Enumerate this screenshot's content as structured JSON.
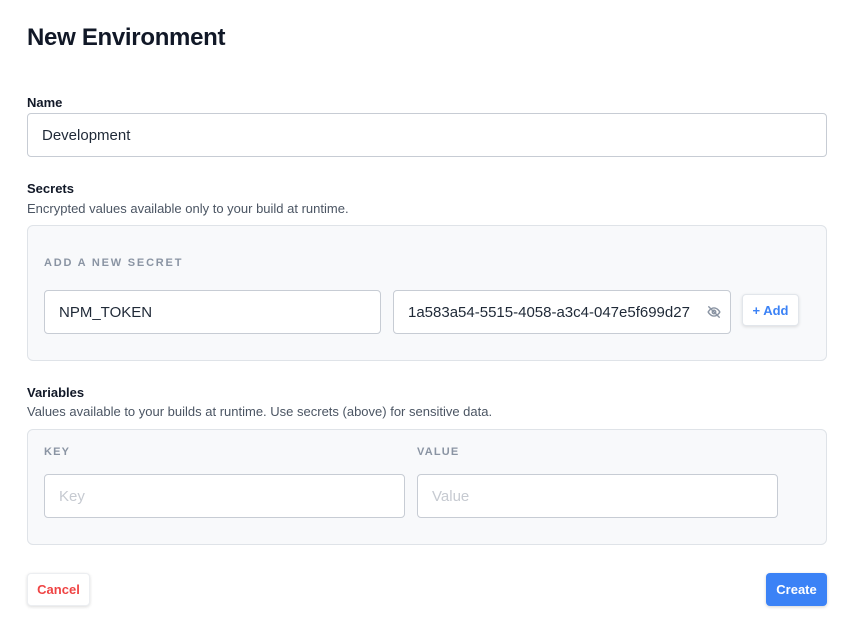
{
  "page": {
    "title": "New Environment"
  },
  "name_field": {
    "label": "Name",
    "value": "Development",
    "placeholder": ""
  },
  "secrets": {
    "label": "Secrets",
    "help": "Encrypted values available only to your build at runtime.",
    "add_heading": "ADD A NEW SECRET",
    "key_value": "NPM_TOKEN",
    "secret_value": "1a583a54-5515-4058-a3c4-047e5f699d27",
    "visibility_icon": "eye-off-icon",
    "add_label": "+ Add"
  },
  "variables": {
    "label": "Variables",
    "help": "Values available to your builds at runtime. Use secrets (above) for sensitive data.",
    "key_heading": "KEY",
    "value_heading": "VALUE",
    "key_placeholder": "Key",
    "value_placeholder": "Value"
  },
  "footer": {
    "cancel_label": "Cancel",
    "create_label": "Create"
  },
  "colors": {
    "accent": "#3b82f6",
    "danger": "#ef4444",
    "panel_bg": "#f8f9fb"
  }
}
